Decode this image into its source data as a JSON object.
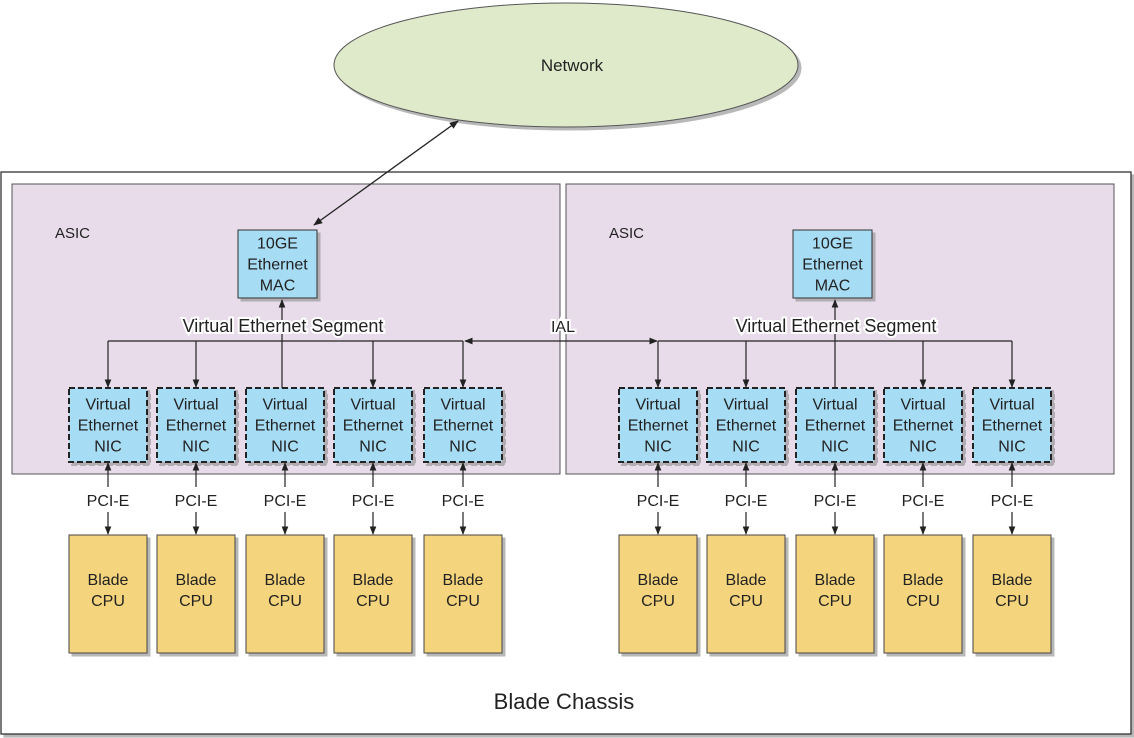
{
  "network": {
    "label": "Network",
    "fill": "#dfeacb"
  },
  "chassis": {
    "label": "Blade Chassis"
  },
  "asics": [
    {
      "label": "ASIC",
      "mac": {
        "lines": [
          "10GE",
          "Ethernet",
          "MAC"
        ]
      },
      "segment_label": "Virtual Ethernet Segment",
      "nics": [
        {
          "lines": [
            "Virtual",
            "Ethernet",
            "NIC"
          ]
        },
        {
          "lines": [
            "Virtual",
            "Ethernet",
            "NIC"
          ]
        },
        {
          "lines": [
            "Virtual",
            "Ethernet",
            "NIC"
          ]
        },
        {
          "lines": [
            "Virtual",
            "Ethernet",
            "NIC"
          ]
        },
        {
          "lines": [
            "Virtual",
            "Ethernet",
            "NIC"
          ]
        }
      ],
      "links": [
        "PCI-E",
        "PCI-E",
        "PCI-E",
        "PCI-E",
        "PCI-E"
      ],
      "cpus": [
        {
          "lines": [
            "Blade",
            "CPU"
          ]
        },
        {
          "lines": [
            "Blade",
            "CPU"
          ]
        },
        {
          "lines": [
            "Blade",
            "CPU"
          ]
        },
        {
          "lines": [
            "Blade",
            "CPU"
          ]
        },
        {
          "lines": [
            "Blade",
            "CPU"
          ]
        }
      ]
    },
    {
      "label": "ASIC",
      "mac": {
        "lines": [
          "10GE",
          "Ethernet",
          "MAC"
        ]
      },
      "segment_label": "Virtual Ethernet Segment",
      "nics": [
        {
          "lines": [
            "Virtual",
            "Ethernet",
            "NIC"
          ]
        },
        {
          "lines": [
            "Virtual",
            "Ethernet",
            "NIC"
          ]
        },
        {
          "lines": [
            "Virtual",
            "Ethernet",
            "NIC"
          ]
        },
        {
          "lines": [
            "Virtual",
            "Ethernet",
            "NIC"
          ]
        },
        {
          "lines": [
            "Virtual",
            "Ethernet",
            "NIC"
          ]
        }
      ],
      "links": [
        "PCI-E",
        "PCI-E",
        "PCI-E",
        "PCI-E",
        "PCI-E"
      ],
      "cpus": [
        {
          "lines": [
            "Blade",
            "CPU"
          ]
        },
        {
          "lines": [
            "Blade",
            "CPU"
          ]
        },
        {
          "lines": [
            "Blade",
            "CPU"
          ]
        },
        {
          "lines": [
            "Blade",
            "CPU"
          ]
        },
        {
          "lines": [
            "Blade",
            "CPU"
          ]
        }
      ]
    }
  ],
  "ial_label": "IAL",
  "colors": {
    "asic_fill": "#e8dcea",
    "mac_fill": "#a6dcf4",
    "nic_fill": "#a6dcf4",
    "cpu_fill": "#f4d47c",
    "stroke": "#333333"
  }
}
